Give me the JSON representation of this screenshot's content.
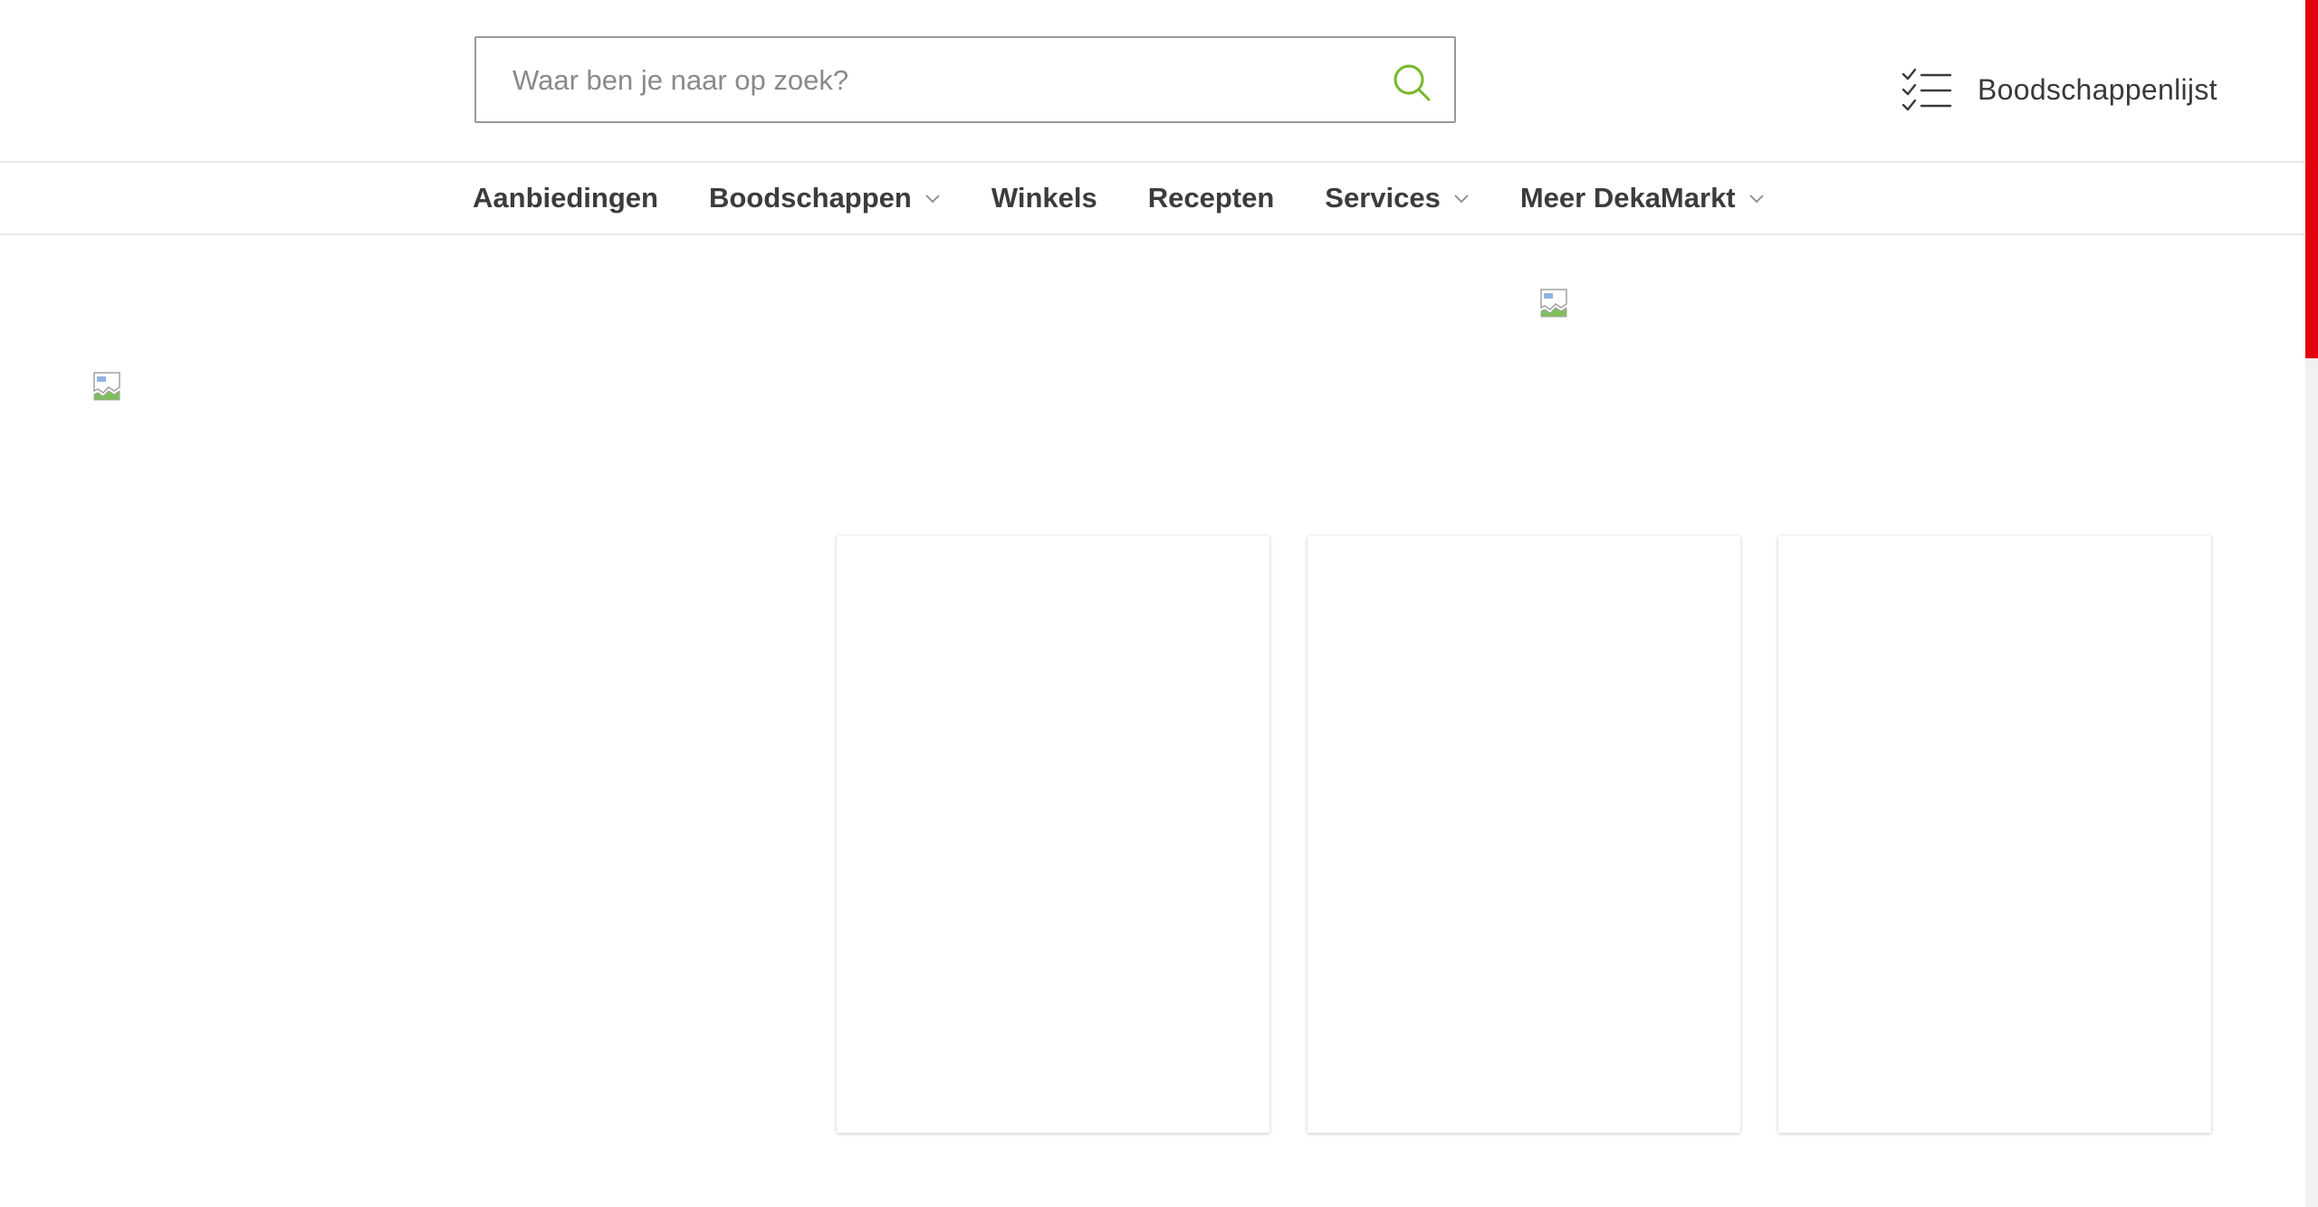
{
  "search": {
    "placeholder": "Waar ben je naar op zoek?",
    "value": ""
  },
  "header": {
    "shopping_list_label": "Boodschappenlijst"
  },
  "nav": {
    "items": [
      {
        "label": "Aanbiedingen",
        "has_dropdown": false
      },
      {
        "label": "Boodschappen",
        "has_dropdown": true
      },
      {
        "label": "Winkels",
        "has_dropdown": false
      },
      {
        "label": "Recepten",
        "has_dropdown": false
      },
      {
        "label": "Services",
        "has_dropdown": true
      },
      {
        "label": "Meer DekaMarkt",
        "has_dropdown": true
      }
    ]
  },
  "colors": {
    "accent_green": "#76b82a",
    "brand_red": "#e3000f",
    "text_dark": "#3c3c3c"
  },
  "icons": {
    "search": "search-icon",
    "shopping_list": "checklist-icon",
    "dropdown": "chevron-down-icon",
    "image_placeholder": "broken-image-icon"
  }
}
